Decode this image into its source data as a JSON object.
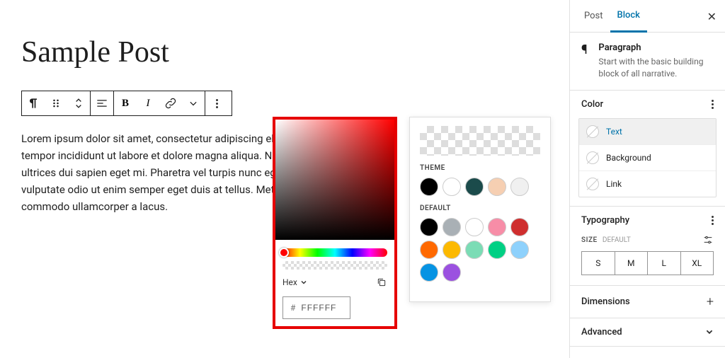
{
  "post": {
    "title": "Sample Post",
    "paragraph": "Lorem ipsum dolor sit amet, consectetur adipiscing elit, sed do eiusmod tempor incididunt ut labore et dolore magna aliqua. Neque viverra justo nec ultrices dui sapien eget mi. Pharetra vel turpis nunc eget lorem dolor. Sed vulputate odio ut enim semper eget duis at tellus. Metus dictum at tempor commodo ullamcorper a lacus."
  },
  "toolbar": {
    "bold": "B",
    "italic": "I"
  },
  "color_picker": {
    "format_label": "Hex",
    "hex_prefix": "#",
    "hex_value": "FFFFFF"
  },
  "swatches": {
    "theme_label": "THEME",
    "default_label": "DEFAULT",
    "theme_colors": [
      "#000000",
      "#ffffff",
      "#1b4b4b",
      "#f6cfb2",
      "#f0f0f0"
    ],
    "default_colors": [
      "#000000",
      "#a9b0b5",
      "#ffffff",
      "#f78da7",
      "#cf2e2e",
      "#ff6900",
      "#fcb900",
      "#7bdcb5",
      "#00d084",
      "#8ed1fc",
      "#0693e3",
      "#9b51e0"
    ]
  },
  "inspector": {
    "tabs": {
      "post": "Post",
      "block": "Block"
    },
    "block": {
      "title": "Paragraph",
      "description": "Start with the basic building block of all narrative."
    },
    "color": {
      "panel_title": "Color",
      "text": "Text",
      "background": "Background",
      "link": "Link"
    },
    "typography": {
      "panel_title": "Typography",
      "size_label": "SIZE",
      "size_default": "DEFAULT",
      "sizes": [
        "S",
        "M",
        "L",
        "XL"
      ]
    },
    "dimensions": {
      "panel_title": "Dimensions"
    },
    "advanced": {
      "panel_title": "Advanced"
    }
  }
}
